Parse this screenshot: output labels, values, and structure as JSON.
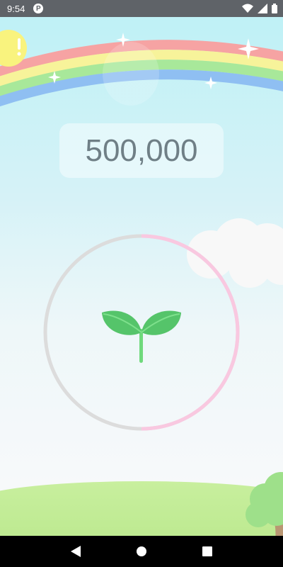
{
  "status_bar": {
    "time": "9:54",
    "app_badge": "P",
    "icons": [
      "wifi-icon",
      "signal-icon",
      "battery-icon"
    ]
  },
  "counter": {
    "value": "500,000"
  },
  "progress": {
    "fraction": 0.5,
    "track_color": "#dcdcdc",
    "fill_color": "#f9c8e0"
  },
  "colors": {
    "rainbow": [
      "#f6a3a3",
      "#f7f39a",
      "#a8e89a",
      "#8fbff2"
    ],
    "sky_top": "#bff1f6",
    "grass": "#bde98e",
    "counter_text": "#6f7f86"
  },
  "nav_bar": {
    "buttons": [
      "back-icon",
      "home-icon",
      "recents-icon"
    ]
  }
}
